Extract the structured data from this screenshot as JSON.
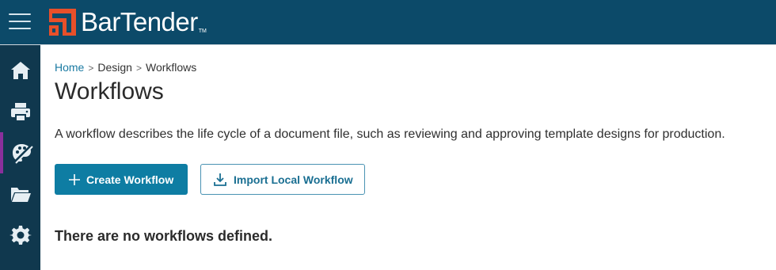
{
  "app": {
    "brand": "BarTender",
    "trademark": "TM"
  },
  "sidebar": {
    "items": [
      {
        "icon": "home-icon"
      },
      {
        "icon": "printer-icon"
      },
      {
        "icon": "design-palette-icon",
        "active": true
      },
      {
        "icon": "folder-icon"
      },
      {
        "icon": "gear-icon"
      }
    ]
  },
  "breadcrumb": {
    "items": [
      "Home",
      "Design",
      "Workflows"
    ],
    "separator": ">"
  },
  "page": {
    "title": "Workflows",
    "description": "A workflow describes the life cycle of a document file, such as reviewing and approving template designs for production.",
    "empty_message": "There are no workflows defined."
  },
  "actions": {
    "create_label": "Create Workflow",
    "import_label": "Import Local Workflow"
  },
  "colors": {
    "header_bg": "#0c4a69",
    "sidebar_bg": "#10384e",
    "accent": "#0e7da3",
    "logo_orange": "#e8502a",
    "active_marker": "#8a2f9c"
  }
}
